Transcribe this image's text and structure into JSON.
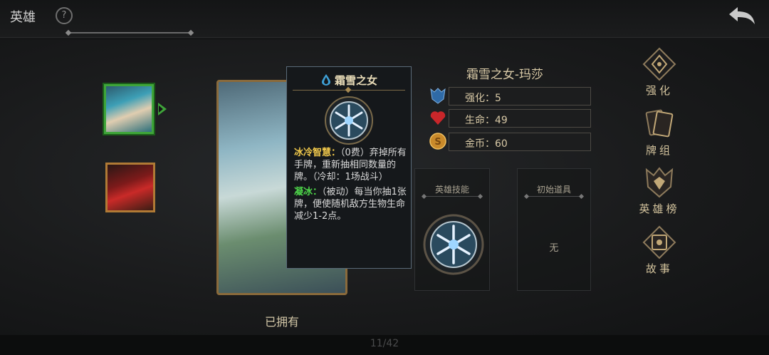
{
  "topbar": {
    "title": "英雄",
    "help_label": "?"
  },
  "hero_name": "霜雪之女-玛莎",
  "stats": [
    {
      "icon": "shield-icon",
      "label": "强化",
      "value": "5"
    },
    {
      "icon": "heart-icon",
      "label": "生命",
      "value": "49"
    },
    {
      "icon": "coin-icon",
      "label": "金币",
      "value": "60"
    }
  ],
  "tooltip": {
    "title": "霜雪之女",
    "skill1_name": "冰冷智慧：",
    "skill1_desc": "（0费）弃掉所有手牌，重新抽相同数量的牌。（冷却：1场战斗）",
    "skill2_name": "凝冰：",
    "skill2_desc": "（被动）每当你抽1张牌，便使随机敌方生物生命减少1-2点。"
  },
  "card_status": "已拥有",
  "panels": {
    "skill_title": "英雄技能",
    "items_title": "初始道具",
    "items_empty": "无"
  },
  "menu": [
    {
      "icon": "enhance-icon",
      "label": "强化"
    },
    {
      "icon": "deck-icon",
      "label": "牌组"
    },
    {
      "icon": "ranking-icon",
      "label": "英雄榜"
    },
    {
      "icon": "story-icon",
      "label": "故事"
    }
  ],
  "pager": "11/42",
  "colors": {
    "accent_gold": "#f0c84b",
    "accent_green": "#4ed64a",
    "selected_border": "#3fa53a"
  }
}
